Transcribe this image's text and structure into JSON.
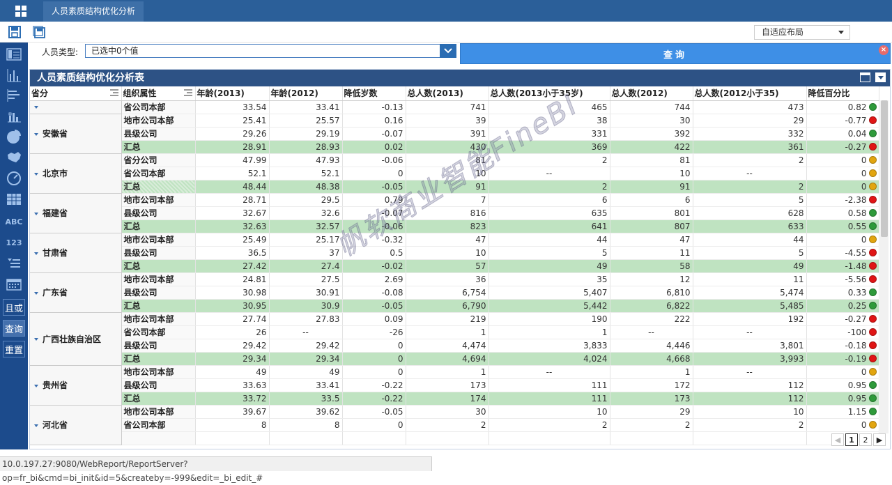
{
  "window": {
    "tab_title": "人员素质结构优化分析"
  },
  "toolbar": {
    "layout_select": "自适应布局"
  },
  "sidebar": {
    "text_items": [
      "ABC",
      "123"
    ],
    "buttons": [
      "且或",
      "查询",
      "重置"
    ]
  },
  "filter": {
    "label": "人员类型:",
    "value": "已选中0个值"
  },
  "query_button": {
    "label": "查询",
    "close": "×"
  },
  "panel": {
    "title": "人员素质结构优化分析表"
  },
  "table": {
    "columns": [
      "省分",
      "组织属性",
      "年龄(2013)",
      "年龄(2012)",
      "降低岁数",
      "总人数(2013)",
      "总人数(2013小于35岁)",
      "总人数(2012)",
      "总人数(2012小于35)",
      "降低百分比"
    ],
    "groups": [
      {
        "province": "",
        "rows": [
          {
            "org": "省公司本部",
            "v": [
              "33.54",
              "33.41",
              "-0.13",
              "741",
              "465",
              "744",
              "473",
              "0.82"
            ],
            "dot": "green",
            "sum": false
          }
        ]
      },
      {
        "province": "安徽省",
        "rows": [
          {
            "org": "地市公司本部",
            "v": [
              "25.41",
              "25.57",
              "0.16",
              "39",
              "38",
              "30",
              "29",
              "-0.77"
            ],
            "dot": "red",
            "sum": false
          },
          {
            "org": "县级公司",
            "v": [
              "29.26",
              "29.19",
              "-0.07",
              "391",
              "331",
              "392",
              "332",
              "0.04"
            ],
            "dot": "green",
            "sum": false
          },
          {
            "org": "汇总",
            "v": [
              "28.91",
              "28.93",
              "0.02",
              "430",
              "369",
              "422",
              "361",
              "-0.27"
            ],
            "dot": "red",
            "sum": true
          }
        ]
      },
      {
        "province": "北京市",
        "rows": [
          {
            "org": "省分公司",
            "v": [
              "47.99",
              "47.93",
              "-0.06",
              "81",
              "2",
              "81",
              "2",
              "0"
            ],
            "dot": "yellow",
            "sum": false
          },
          {
            "org": "省公司本部",
            "v": [
              "52.1",
              "52.1",
              "0",
              "10",
              "--",
              "10",
              "--",
              "0"
            ],
            "dot": "yellow",
            "sum": false
          },
          {
            "org": "汇总",
            "v": [
              "48.44",
              "48.38",
              "-0.05",
              "91",
              "2",
              "91",
              "2",
              "0"
            ],
            "dot": "yellow",
            "sum": true
          }
        ]
      },
      {
        "province": "福建省",
        "rows": [
          {
            "org": "地市公司本部",
            "v": [
              "28.71",
              "29.5",
              "0.79",
              "7",
              "6",
              "6",
              "5",
              "-2.38"
            ],
            "dot": "red",
            "sum": false
          },
          {
            "org": "县级公司",
            "v": [
              "32.67",
              "32.6",
              "-0.07",
              "816",
              "635",
              "801",
              "628",
              "0.58"
            ],
            "dot": "green",
            "sum": false
          },
          {
            "org": "汇总",
            "v": [
              "32.63",
              "32.57",
              "-0.06",
              "823",
              "641",
              "807",
              "633",
              "0.55"
            ],
            "dot": "green",
            "sum": true
          }
        ]
      },
      {
        "province": "甘肃省",
        "rows": [
          {
            "org": "地市公司本部",
            "v": [
              "25.49",
              "25.17",
              "-0.32",
              "47",
              "44",
              "47",
              "44",
              "0"
            ],
            "dot": "yellow",
            "sum": false
          },
          {
            "org": "县级公司",
            "v": [
              "36.5",
              "37",
              "0.5",
              "10",
              "5",
              "11",
              "5",
              "-4.55"
            ],
            "dot": "red",
            "sum": false
          },
          {
            "org": "汇总",
            "v": [
              "27.42",
              "27.4",
              "-0.02",
              "57",
              "49",
              "58",
              "49",
              "-1.48"
            ],
            "dot": "red",
            "sum": true
          }
        ]
      },
      {
        "province": "广东省",
        "rows": [
          {
            "org": "地市公司本部",
            "v": [
              "24.81",
              "27.5",
              "2.69",
              "36",
              "35",
              "12",
              "11",
              "-5.56"
            ],
            "dot": "red",
            "sum": false
          },
          {
            "org": "县级公司",
            "v": [
              "30.98",
              "30.91",
              "-0.08",
              "6,754",
              "5,407",
              "6,810",
              "5,474",
              "0.33"
            ],
            "dot": "green",
            "sum": false
          },
          {
            "org": "汇总",
            "v": [
              "30.95",
              "30.9",
              "-0.05",
              "6,790",
              "5,442",
              "6,822",
              "5,485",
              "0.25"
            ],
            "dot": "green",
            "sum": true
          }
        ]
      },
      {
        "province": "广西壮族自治区",
        "rows": [
          {
            "org": "地市公司本部",
            "v": [
              "27.74",
              "27.83",
              "0.09",
              "219",
              "190",
              "222",
              "192",
              "-0.27"
            ],
            "dot": "red",
            "sum": false
          },
          {
            "org": "省公司本部",
            "v": [
              "26",
              "--",
              "-26",
              "1",
              "1",
              "--",
              "--",
              "-100"
            ],
            "dot": "red",
            "sum": false
          },
          {
            "org": "县级公司",
            "v": [
              "29.42",
              "29.42",
              "0",
              "4,474",
              "3,833",
              "4,446",
              "3,801",
              "-0.18"
            ],
            "dot": "red",
            "sum": false
          },
          {
            "org": "汇总",
            "v": [
              "29.34",
              "29.34",
              "0",
              "4,694",
              "4,024",
              "4,668",
              "3,993",
              "-0.19"
            ],
            "dot": "red",
            "sum": true
          }
        ]
      },
      {
        "province": "贵州省",
        "rows": [
          {
            "org": "地市公司本部",
            "v": [
              "49",
              "49",
              "0",
              "1",
              "--",
              "1",
              "--",
              "0"
            ],
            "dot": "yellow",
            "sum": false
          },
          {
            "org": "县级公司",
            "v": [
              "33.63",
              "33.41",
              "-0.22",
              "173",
              "111",
              "172",
              "112",
              "0.95"
            ],
            "dot": "green",
            "sum": false
          },
          {
            "org": "汇总",
            "v": [
              "33.72",
              "33.5",
              "-0.22",
              "174",
              "111",
              "173",
              "112",
              "0.95"
            ],
            "dot": "green",
            "sum": true
          }
        ]
      },
      {
        "province": "河北省",
        "rows": [
          {
            "org": "地市公司本部",
            "v": [
              "39.67",
              "39.62",
              "-0.05",
              "30",
              "10",
              "29",
              "10",
              "1.15"
            ],
            "dot": "green",
            "sum": false
          },
          {
            "org": "省公司本部",
            "v": [
              "8",
              "8",
              "0",
              "2",
              "2",
              "2",
              "2",
              "0"
            ],
            "dot": "yellow",
            "sum": false
          },
          {
            "org": "",
            "v": [
              "",
              "",
              "",
              "",
              "",
              "",
              "",
              ""
            ],
            "dot": "",
            "sum": false
          }
        ]
      }
    ]
  },
  "pager": {
    "prev": "◀",
    "pages": [
      "1",
      "2"
    ],
    "next": "▶"
  },
  "watermark": "帆软商业智能FineBI",
  "statusbar": {
    "url": "10.0.197.27:9080/WebReport/ReportServer?op=fr_bi&cmd=bi_init&id=5&createby=-999&edit=_bi_edit_#"
  },
  "colors": {
    "header_blue": "#2b5f99",
    "panel_title": "#2d5285",
    "sum_row": "#bfe3c1",
    "dot_green": "#2e9a3a",
    "dot_red": "#e01515",
    "dot_yellow": "#e2a50f"
  }
}
